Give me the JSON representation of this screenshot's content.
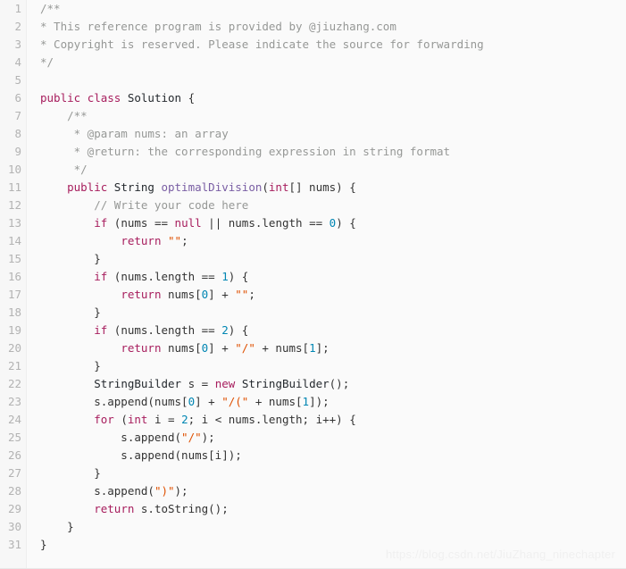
{
  "editor": {
    "language": "java",
    "background_color": "#fafafa",
    "gutter_color": "#f7f7f7",
    "first_line_number": 1,
    "last_line_number": 31,
    "total_lines": 31,
    "colors": {
      "keyword": "#a71d5d",
      "string": "#df5000",
      "comment": "#969896",
      "function": "#795da3",
      "type": "#24292e",
      "number": "#0086b3",
      "plain": "#333333",
      "line_number": "#b3b3b3"
    }
  },
  "watermark": {
    "text": "https://blog.csdn.net/JiuZhang_ninechapter"
  },
  "line_numbers": [
    "1",
    "2",
    "3",
    "4",
    "5",
    "6",
    "7",
    "8",
    "9",
    "10",
    "11",
    "12",
    "13",
    "14",
    "15",
    "16",
    "17",
    "18",
    "19",
    "20",
    "21",
    "22",
    "23",
    "24",
    "25",
    "26",
    "27",
    "28",
    "29",
    "30",
    "31"
  ],
  "code_lines": [
    {
      "n": 1,
      "text": "/**"
    },
    {
      "n": 2,
      "text": "* This reference program is provided by @jiuzhang.com"
    },
    {
      "n": 3,
      "text": "* Copyright is reserved. Please indicate the source for forwarding"
    },
    {
      "n": 4,
      "text": "*/"
    },
    {
      "n": 5,
      "text": ""
    },
    {
      "n": 6,
      "text": "public class Solution {"
    },
    {
      "n": 7,
      "text": "    /**"
    },
    {
      "n": 8,
      "text": "     * @param nums: an array"
    },
    {
      "n": 9,
      "text": "     * @return: the corresponding expression in string format"
    },
    {
      "n": 10,
      "text": "     */"
    },
    {
      "n": 11,
      "text": "    public String optimalDivision(int[] nums) {"
    },
    {
      "n": 12,
      "text": "        // Write your code here"
    },
    {
      "n": 13,
      "text": "        if (nums == null || nums.length == 0) {"
    },
    {
      "n": 14,
      "text": "            return \"\";"
    },
    {
      "n": 15,
      "text": "        }"
    },
    {
      "n": 16,
      "text": "        if (nums.length == 1) {"
    },
    {
      "n": 17,
      "text": "            return nums[0] + \"\";"
    },
    {
      "n": 18,
      "text": "        }"
    },
    {
      "n": 19,
      "text": "        if (nums.length == 2) {"
    },
    {
      "n": 20,
      "text": "            return nums[0] + \"/\" + nums[1];"
    },
    {
      "n": 21,
      "text": "        }"
    },
    {
      "n": 22,
      "text": "        StringBuilder s = new StringBuilder();"
    },
    {
      "n": 23,
      "text": "        s.append(nums[0] + \"/(\" + nums[1]);"
    },
    {
      "n": 24,
      "text": "        for (int i = 2; i < nums.length; i++) {"
    },
    {
      "n": 25,
      "text": "            s.append(\"/\");"
    },
    {
      "n": 26,
      "text": "            s.append(nums[i]);"
    },
    {
      "n": 27,
      "text": "        }"
    },
    {
      "n": 28,
      "text": "        s.append(\")\");"
    },
    {
      "n": 29,
      "text": "        return s.toString();"
    },
    {
      "n": 30,
      "text": "    }"
    },
    {
      "n": 31,
      "text": "}"
    }
  ],
  "tokenized_lines": [
    [
      {
        "t": "/**",
        "c": "cmt"
      }
    ],
    [
      {
        "t": "* This reference program is provided by @jiuzhang.com",
        "c": "cmt"
      }
    ],
    [
      {
        "t": "* Copyright is reserved. Please indicate the source for forwarding",
        "c": "cmt"
      }
    ],
    [
      {
        "t": "*/",
        "c": "cmt"
      }
    ],
    [],
    [
      {
        "t": "public",
        "c": "kw"
      },
      {
        "t": " ",
        "c": "pl"
      },
      {
        "t": "class",
        "c": "kw"
      },
      {
        "t": " ",
        "c": "pl"
      },
      {
        "t": "Solution",
        "c": "type"
      },
      {
        "t": " {",
        "c": "pl"
      }
    ],
    [
      {
        "t": "    /**",
        "c": "cmt"
      }
    ],
    [
      {
        "t": "     * @param nums: an array",
        "c": "cmt"
      }
    ],
    [
      {
        "t": "     * @return: the corresponding expression in string format",
        "c": "cmt"
      }
    ],
    [
      {
        "t": "     */",
        "c": "cmt"
      }
    ],
    [
      {
        "t": "    ",
        "c": "pl"
      },
      {
        "t": "public",
        "c": "kw"
      },
      {
        "t": " ",
        "c": "pl"
      },
      {
        "t": "String",
        "c": "type"
      },
      {
        "t": " ",
        "c": "pl"
      },
      {
        "t": "optimalDivision",
        "c": "fn"
      },
      {
        "t": "(",
        "c": "pl"
      },
      {
        "t": "int",
        "c": "kw"
      },
      {
        "t": "[] nums) {",
        "c": "pl"
      }
    ],
    [
      {
        "t": "        // Write your code here",
        "c": "cmt"
      }
    ],
    [
      {
        "t": "        ",
        "c": "pl"
      },
      {
        "t": "if",
        "c": "kw"
      },
      {
        "t": " (nums == ",
        "c": "pl"
      },
      {
        "t": "null",
        "c": "kw"
      },
      {
        "t": " || nums.length == ",
        "c": "pl"
      },
      {
        "t": "0",
        "c": "num"
      },
      {
        "t": ") {",
        "c": "pl"
      }
    ],
    [
      {
        "t": "            ",
        "c": "pl"
      },
      {
        "t": "return",
        "c": "kw"
      },
      {
        "t": " ",
        "c": "pl"
      },
      {
        "t": "\"\"",
        "c": "str"
      },
      {
        "t": ";",
        "c": "pl"
      }
    ],
    [
      {
        "t": "        }",
        "c": "pl"
      }
    ],
    [
      {
        "t": "        ",
        "c": "pl"
      },
      {
        "t": "if",
        "c": "kw"
      },
      {
        "t": " (nums.length == ",
        "c": "pl"
      },
      {
        "t": "1",
        "c": "num"
      },
      {
        "t": ") {",
        "c": "pl"
      }
    ],
    [
      {
        "t": "            ",
        "c": "pl"
      },
      {
        "t": "return",
        "c": "kw"
      },
      {
        "t": " nums[",
        "c": "pl"
      },
      {
        "t": "0",
        "c": "num"
      },
      {
        "t": "] + ",
        "c": "pl"
      },
      {
        "t": "\"\"",
        "c": "str"
      },
      {
        "t": ";",
        "c": "pl"
      }
    ],
    [
      {
        "t": "        }",
        "c": "pl"
      }
    ],
    [
      {
        "t": "        ",
        "c": "pl"
      },
      {
        "t": "if",
        "c": "kw"
      },
      {
        "t": " (nums.length == ",
        "c": "pl"
      },
      {
        "t": "2",
        "c": "num"
      },
      {
        "t": ") {",
        "c": "pl"
      }
    ],
    [
      {
        "t": "            ",
        "c": "pl"
      },
      {
        "t": "return",
        "c": "kw"
      },
      {
        "t": " nums[",
        "c": "pl"
      },
      {
        "t": "0",
        "c": "num"
      },
      {
        "t": "] + ",
        "c": "pl"
      },
      {
        "t": "\"/\"",
        "c": "str"
      },
      {
        "t": " + nums[",
        "c": "pl"
      },
      {
        "t": "1",
        "c": "num"
      },
      {
        "t": "];",
        "c": "pl"
      }
    ],
    [
      {
        "t": "        }",
        "c": "pl"
      }
    ],
    [
      {
        "t": "        ",
        "c": "pl"
      },
      {
        "t": "StringBuilder",
        "c": "type"
      },
      {
        "t": " s = ",
        "c": "pl"
      },
      {
        "t": "new",
        "c": "kw"
      },
      {
        "t": " ",
        "c": "pl"
      },
      {
        "t": "StringBuilder",
        "c": "type"
      },
      {
        "t": "();",
        "c": "pl"
      }
    ],
    [
      {
        "t": "        s.append(nums[",
        "c": "pl"
      },
      {
        "t": "0",
        "c": "num"
      },
      {
        "t": "] + ",
        "c": "pl"
      },
      {
        "t": "\"/(\"",
        "c": "str"
      },
      {
        "t": " + nums[",
        "c": "pl"
      },
      {
        "t": "1",
        "c": "num"
      },
      {
        "t": "]);",
        "c": "pl"
      }
    ],
    [
      {
        "t": "        ",
        "c": "pl"
      },
      {
        "t": "for",
        "c": "kw"
      },
      {
        "t": " (",
        "c": "pl"
      },
      {
        "t": "int",
        "c": "kw"
      },
      {
        "t": " i = ",
        "c": "pl"
      },
      {
        "t": "2",
        "c": "num"
      },
      {
        "t": "; i < nums.length; i++) {",
        "c": "pl"
      }
    ],
    [
      {
        "t": "            s.append(",
        "c": "pl"
      },
      {
        "t": "\"/\"",
        "c": "str"
      },
      {
        "t": ");",
        "c": "pl"
      }
    ],
    [
      {
        "t": "            s.append(nums[i]);",
        "c": "pl"
      }
    ],
    [
      {
        "t": "        }",
        "c": "pl"
      }
    ],
    [
      {
        "t": "        s.append(",
        "c": "pl"
      },
      {
        "t": "\")\"",
        "c": "str"
      },
      {
        "t": ");",
        "c": "pl"
      }
    ],
    [
      {
        "t": "        ",
        "c": "pl"
      },
      {
        "t": "return",
        "c": "kw"
      },
      {
        "t": " s.toString();",
        "c": "pl"
      }
    ],
    [
      {
        "t": "    }",
        "c": "pl"
      }
    ],
    [
      {
        "t": "}",
        "c": "pl"
      }
    ]
  ]
}
